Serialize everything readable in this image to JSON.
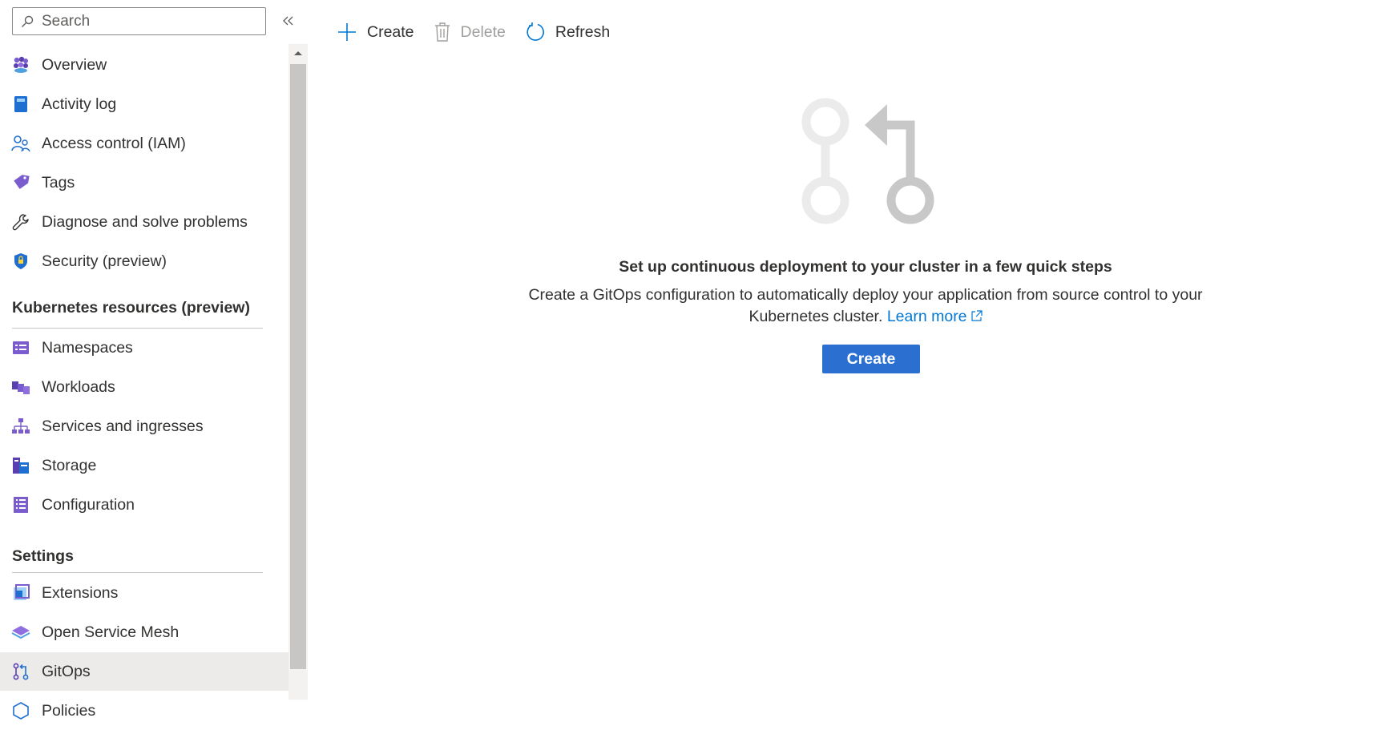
{
  "search": {
    "placeholder": "Search"
  },
  "sidebar": {
    "items_top": [
      {
        "label": "Overview",
        "icon": "overview-icon"
      },
      {
        "label": "Activity log",
        "icon": "activity-log-icon"
      },
      {
        "label": "Access control (IAM)",
        "icon": "access-control-icon"
      },
      {
        "label": "Tags",
        "icon": "tag-icon"
      },
      {
        "label": "Diagnose and solve problems",
        "icon": "wrench-icon"
      },
      {
        "label": "Security (preview)",
        "icon": "shield-icon"
      }
    ],
    "section_k8s": {
      "title": "Kubernetes resources (preview)",
      "items": [
        {
          "label": "Namespaces",
          "icon": "namespaces-icon"
        },
        {
          "label": "Workloads",
          "icon": "workloads-icon"
        },
        {
          "label": "Services and ingresses",
          "icon": "services-icon"
        },
        {
          "label": "Storage",
          "icon": "storage-icon"
        },
        {
          "label": "Configuration",
          "icon": "configuration-icon"
        }
      ]
    },
    "section_settings": {
      "title": "Settings",
      "items": [
        {
          "label": "Extensions",
          "icon": "extensions-icon"
        },
        {
          "label": "Open Service Mesh",
          "icon": "service-mesh-icon"
        },
        {
          "label": "GitOps",
          "icon": "gitops-icon",
          "selected": true
        },
        {
          "label": "Policies",
          "icon": "policies-icon"
        }
      ]
    }
  },
  "toolbar": {
    "create_label": "Create",
    "delete_label": "Delete",
    "refresh_label": "Refresh"
  },
  "empty_state": {
    "title": "Set up continuous deployment to your cluster in a few quick steps",
    "description": "Create a GitOps configuration to automatically deploy your application from source control to your Kubernetes cluster.",
    "learn_more": "Learn more",
    "button_label": "Create"
  },
  "colors": {
    "accent": "#2b6fd1",
    "link": "#0078d4",
    "selected_bg": "#edebe9",
    "illustration_light": "#e8e8e8",
    "illustration_dark": "#c8c8c8"
  }
}
